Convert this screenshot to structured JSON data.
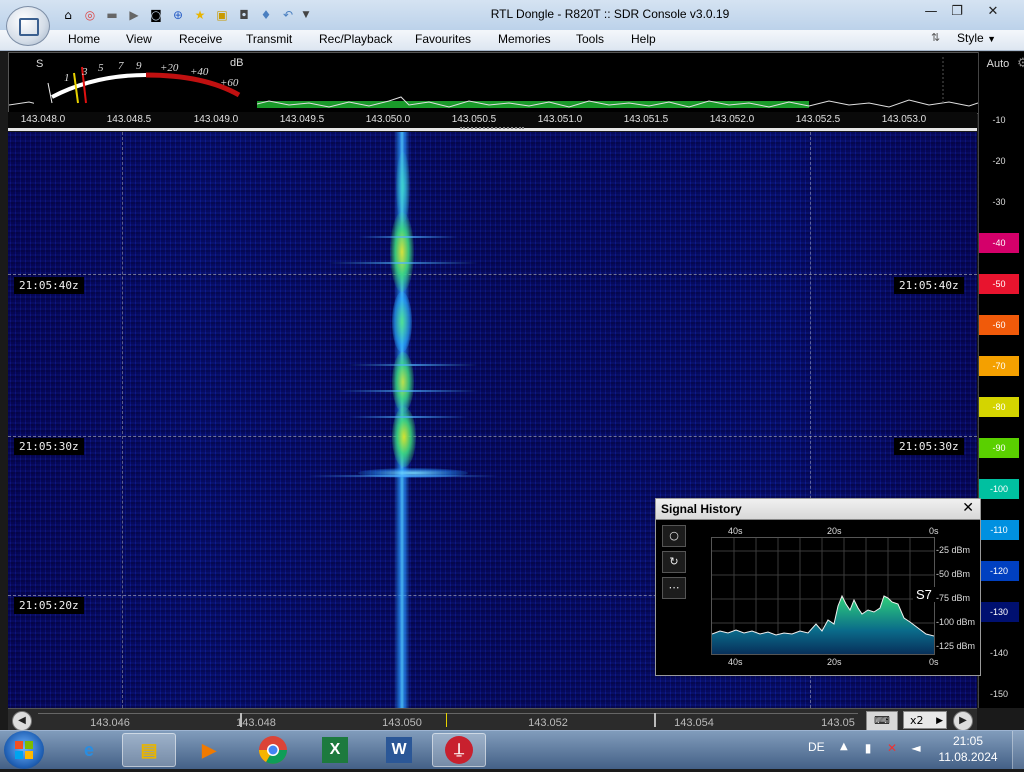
{
  "window": {
    "title": "RTL Dongle - R820T :: SDR Console v3.0.19",
    "minimize_icon": "minimize-icon",
    "maximize_icon": "maximize-icon",
    "close_icon": "close-icon"
  },
  "menu": {
    "items": [
      "Home",
      "View",
      "Receive",
      "Transmit",
      "Rec/Playback",
      "Favourites",
      "Memories",
      "Tools",
      "Help"
    ],
    "style_label": "Style"
  },
  "smeter": {
    "s_label": "S",
    "db_label": "dB",
    "s_scale": [
      "1",
      "3",
      "5",
      "7",
      "9"
    ],
    "db_scale": [
      "+20",
      "+40",
      "+60"
    ]
  },
  "spectrum": {
    "freq_ticks": [
      "143.048.0",
      "143.048.5",
      "143.049.0",
      "143.049.5",
      "143.050.0",
      "143.050.5",
      "143.051.0",
      "143.051.5",
      "143.052.0",
      "143.052.5",
      "143.053.0"
    ]
  },
  "dbscale": {
    "auto_label": "Auto",
    "ticks": [
      "-10",
      "-20",
      "-30",
      "-40",
      "-50",
      "-60",
      "-70",
      "-80",
      "-90",
      "-100",
      "-110",
      "-120",
      "-130",
      "-140",
      "-150"
    ],
    "colors": [
      "#000000",
      "#000000",
      "#000000",
      "#d4006a",
      "#e8142e",
      "#f05a0a",
      "#f4a000",
      "#d4d400",
      "#5ad000",
      "#00c0a0",
      "#0090e0",
      "#0040c0",
      "#001070",
      "#000000",
      "#000000"
    ]
  },
  "waterfall": {
    "time_labels": [
      "21:05:40z",
      "21:05:30z",
      "21:05:20z"
    ]
  },
  "signal_history": {
    "title": "Signal History",
    "top_axis": [
      "40s",
      "20s",
      "0s"
    ],
    "bottom_axis": [
      "40s",
      "20s",
      "0s"
    ],
    "dbm_labels": [
      "-25 dBm",
      "-50 dBm",
      "-75 dBm",
      "-100 dBm",
      "-125 dBm"
    ],
    "s_reading": "S7"
  },
  "timeline": {
    "labels": [
      "143.046",
      "143.048",
      "143.050",
      "143.052",
      "143.054",
      "143.05"
    ],
    "zoom_label": "x2"
  },
  "taskbar": {
    "apps": [
      "Internet Explorer",
      "Windows Explorer",
      "Media Player",
      "Chrome",
      "Excel",
      "Word",
      "SDR Console"
    ],
    "language": "DE",
    "time": "21:05",
    "date": "11.08.2024"
  }
}
